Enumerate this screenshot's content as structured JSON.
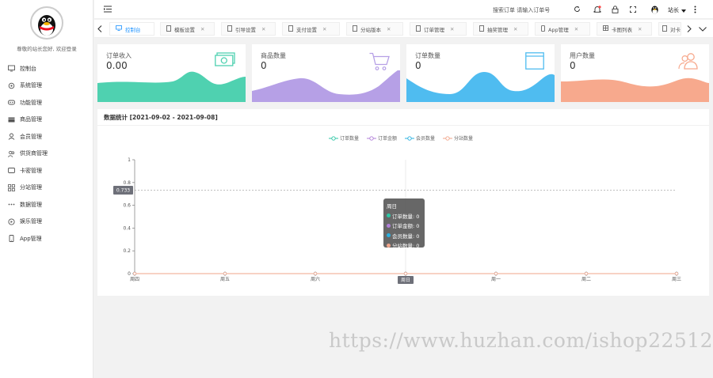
{
  "sidebar": {
    "welcome": "尊敬的站长您好, 欢迎登录",
    "items": [
      {
        "label": "控制台",
        "icon": "monitor-icon"
      },
      {
        "label": "系统管理",
        "icon": "gear-icon"
      },
      {
        "label": "功能管理",
        "icon": "apps-icon"
      },
      {
        "label": "商品管理",
        "icon": "box-icon"
      },
      {
        "label": "会员管理",
        "icon": "user-icon"
      },
      {
        "label": "供货商管理",
        "icon": "users-icon"
      },
      {
        "label": "卡密管理",
        "icon": "card-icon"
      },
      {
        "label": "分站管理",
        "icon": "grid-icon"
      },
      {
        "label": "数据管理",
        "icon": "dots-icon"
      },
      {
        "label": "娱乐管理",
        "icon": "game-icon"
      },
      {
        "label": "App管理",
        "icon": "phone-icon"
      }
    ]
  },
  "topbar": {
    "search_placeholder": "搜索订单 请输入订单号",
    "username": "站长"
  },
  "tabs": [
    {
      "label": "控制台",
      "closable": false,
      "active": true
    },
    {
      "label": "模板设置",
      "closable": true
    },
    {
      "label": "引导设置",
      "closable": true
    },
    {
      "label": "支付设置",
      "closable": true
    },
    {
      "label": "分站版本",
      "closable": true
    },
    {
      "label": "订单管理",
      "closable": true
    },
    {
      "label": "抽奖管理",
      "closable": true
    },
    {
      "label": "App管理",
      "closable": true
    },
    {
      "label": "卡图列表",
      "closable": true
    },
    {
      "label": "对卡",
      "closable": false
    }
  ],
  "cards": [
    {
      "title": "订单收入",
      "value": "0.00",
      "color": "#4fd1b0",
      "icon": "money-icon"
    },
    {
      "title": "商品数量",
      "value": "0",
      "color": "#b6a0e6",
      "icon": "cart-icon"
    },
    {
      "title": "订单数量",
      "value": "0",
      "color": "#4fbcf0",
      "icon": "window-icon"
    },
    {
      "title": "用户数量",
      "value": "0",
      "color": "#f7a98d",
      "icon": "people-icon"
    }
  ],
  "panel": {
    "title": "数据统计 [2021-09-02 - 2021-09-08]"
  },
  "chart_data": {
    "type": "line",
    "categories": [
      "周四",
      "周五",
      "周六",
      "周日",
      "周一",
      "周二",
      "周三"
    ],
    "series": [
      {
        "name": "订单数量",
        "values": [
          0,
          0,
          0,
          0,
          0,
          0,
          0
        ],
        "color": "#2ec7a5"
      },
      {
        "name": "订单金额",
        "values": [
          0,
          0,
          0,
          0,
          0,
          0,
          0
        ],
        "color": "#b07fd8"
      },
      {
        "name": "会员数量",
        "values": [
          0,
          0,
          0,
          0,
          0,
          0,
          0
        ],
        "color": "#2ab0e0"
      },
      {
        "name": "分站数量",
        "values": [
          0,
          0,
          0,
          0,
          0,
          0,
          0
        ],
        "color": "#f2a58a"
      }
    ],
    "ylim": [
      0,
      1
    ],
    "yticks": [
      "0",
      "0.2",
      "0.4",
      "0.6",
      "0.8",
      "1"
    ],
    "crosshair_label": "0.733",
    "crosshair_value": 0.733,
    "crosshair_category": "周日",
    "tooltip": {
      "title": "周日",
      "rows": [
        "订单数量: 0",
        "订单金额: 0",
        "会员数量: 0",
        "分站数量: 0"
      ]
    },
    "legend": "top-center",
    "grid": false
  },
  "watermark": "https://www.huzhan.com/ishop22512"
}
